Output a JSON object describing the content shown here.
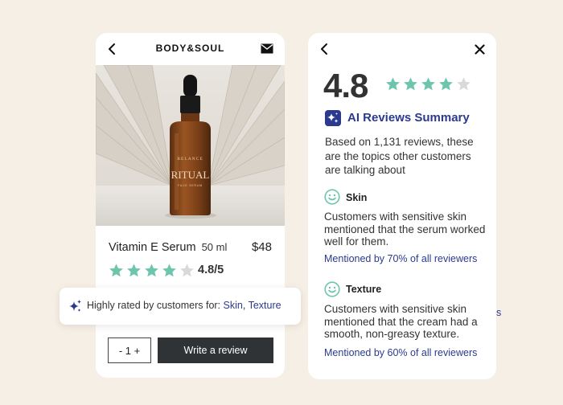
{
  "product_card": {
    "brand": "BODY&SOUL",
    "bottle_brand": "RELANCE",
    "bottle_label": "RITUAL",
    "bottle_sub": "FACE SERUM",
    "product_name": "Vitamin E Serum",
    "size": "50 ml",
    "price": "$48",
    "rating": 4.8,
    "rating_label": "4.8/5",
    "quantity": "- 1 +",
    "write_review_label": "Write a review"
  },
  "highlight": {
    "prefix": "Highly rated by customers for:",
    "tags": [
      "Skin",
      "Texture"
    ],
    "separator": ","
  },
  "summary_card": {
    "rating": "4.8",
    "stars": 4,
    "title": "AI Reviews Summary",
    "intro": "Based on 1,131 reviews, these are the topics other customers are talking about",
    "topics": [
      {
        "name": "Skin",
        "text": "Customers with sensitive skin mentioned that the serum worked well for them.",
        "mention": "Mentioned by 70% of all reviewers"
      },
      {
        "name": "Texture",
        "text": "Customers with sensitive skin mentioned that the cream had a smooth, non-greasy texture.",
        "mention": "Mentioned by 60% of all reviewers"
      }
    ],
    "peek": "s"
  },
  "colors": {
    "background": "#f6efe5",
    "star_filled": "#6ec5ad",
    "star_empty": "#d9d9d9",
    "accent": "#2b3a8e",
    "button_dark": "#2f3336"
  }
}
